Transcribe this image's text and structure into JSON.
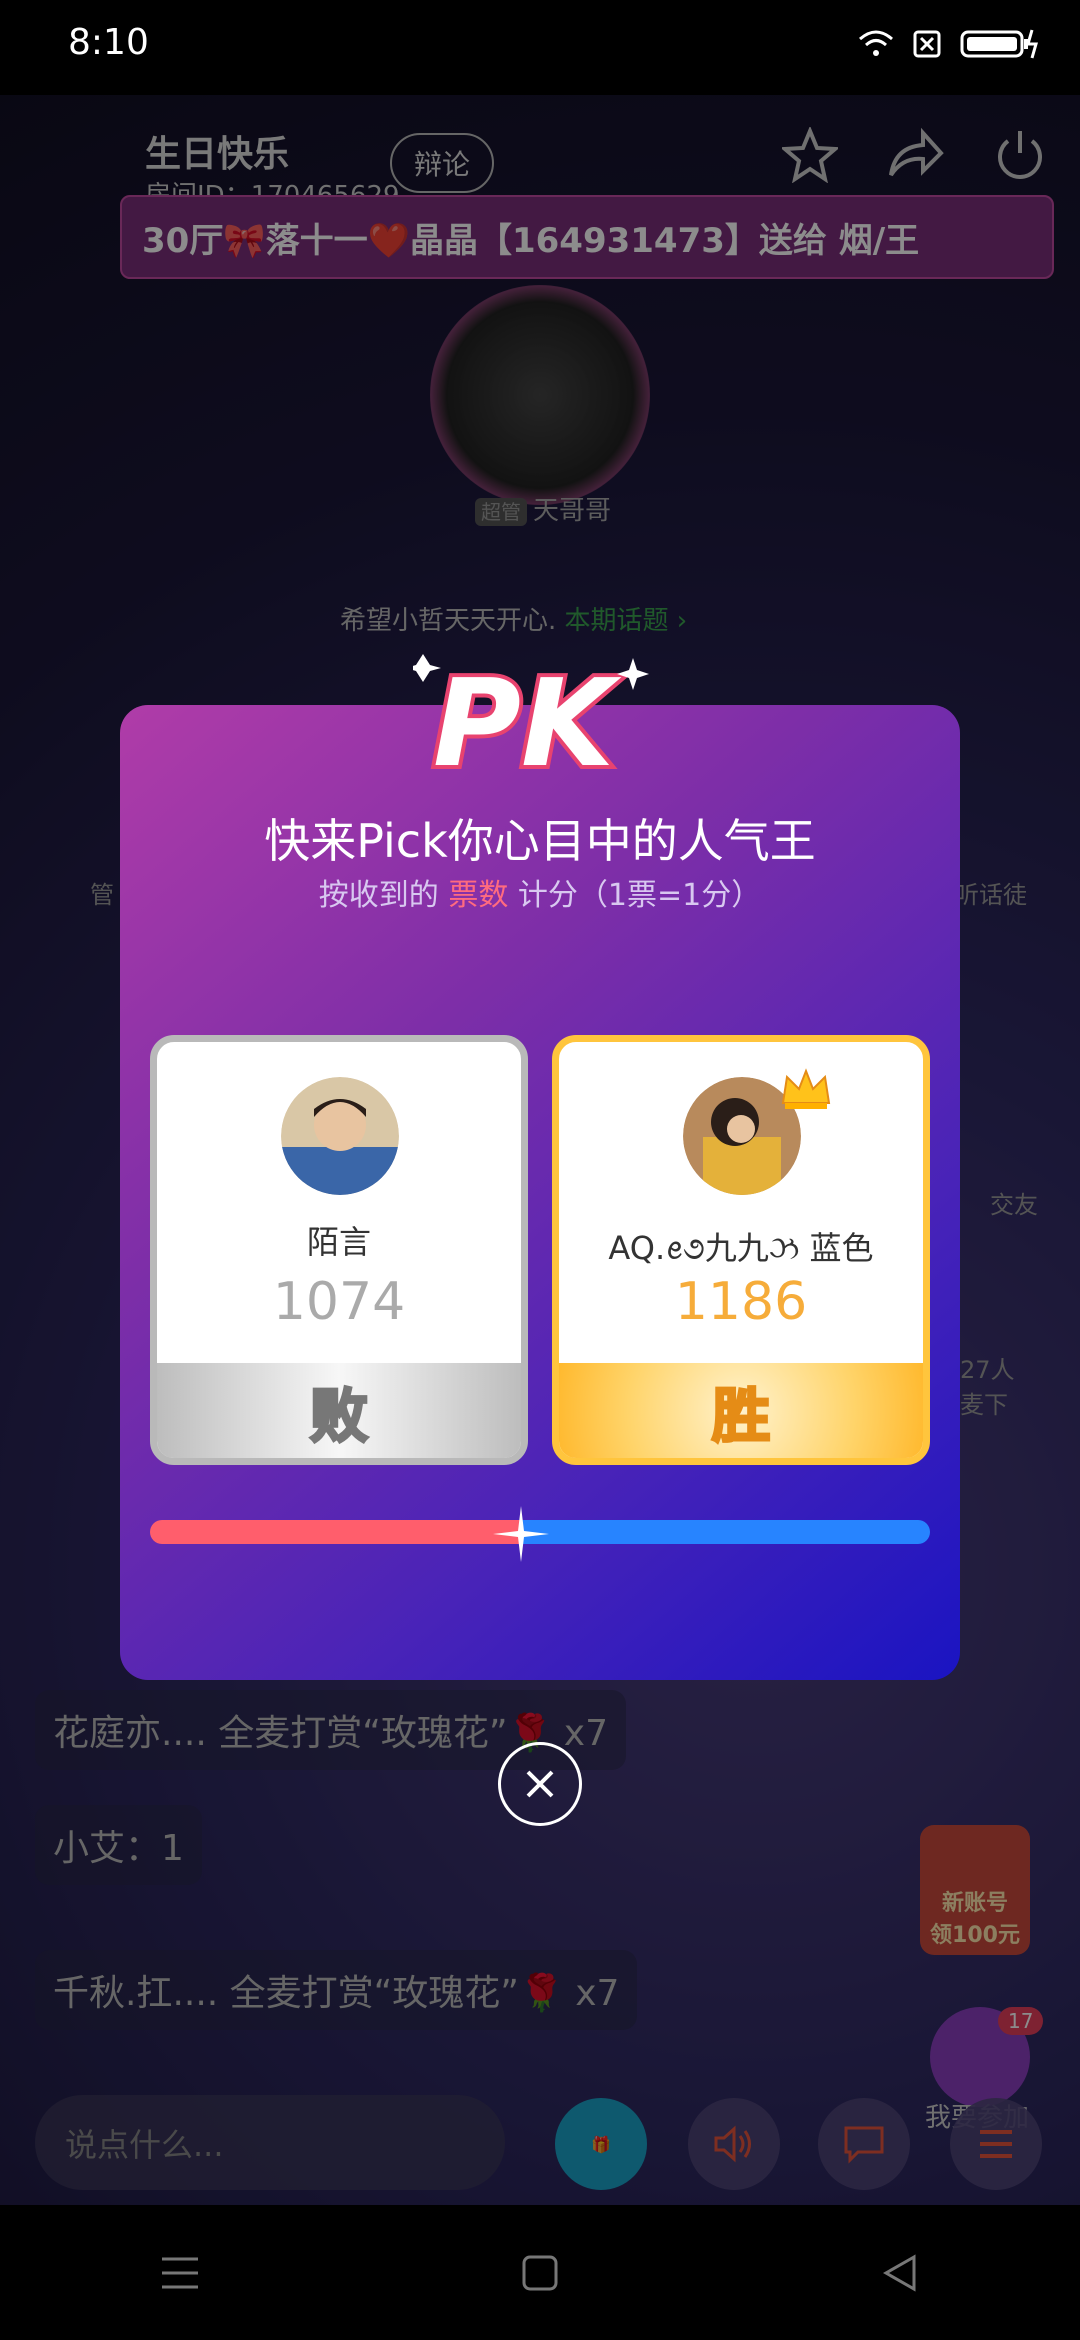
{
  "status_bar": {
    "time": "8:10"
  },
  "room": {
    "title": "生日快乐",
    "id_text": "房间ID：170465629",
    "debate_label": "辩论",
    "marquee_text": "30厅🎀落十一❤️晶晶【164931473】送给 烟/王",
    "host": {
      "badge": "超管",
      "name": "天哥哥"
    },
    "topic": {
      "text": "希望小哲天天开心.",
      "link": "本期话题 ›"
    },
    "side_labels": {
      "left_top": "管",
      "right_top": "听话徒",
      "right_mid": "交友",
      "right_low": "27人\n麦下"
    },
    "chat": [
      {
        "text": "花庭亦.... 全麦打赏“玫瑰花”🌹 x7"
      },
      {
        "text": "小艾：1"
      },
      {
        "text": "千秋.扛.... 全麦打赏“玫瑰花”🌹 x7"
      }
    ],
    "input_placeholder": "说点什么...",
    "promo_text": "新账号\n领100元",
    "join": {
      "count": "17",
      "label": "我要参加"
    }
  },
  "modal": {
    "logo": "PK",
    "title": "快来Pick你心目中的人气王",
    "subtitle_prefix": "按收到的 ",
    "subtitle_highlight": "票数",
    "subtitle_suffix": " 计分（1票=1分）",
    "left": {
      "name": "陌言",
      "score": "1074",
      "result": "败",
      "share": 0.475
    },
    "right": {
      "name": "AQ.ꫀ૭九九ઝ 蓝色",
      "score": "1186",
      "result": "胜",
      "share": 0.525
    }
  },
  "colors": {
    "accent_red": "#ff5e6c",
    "accent_blue": "#2784ff",
    "win_gold": "#f6ac3a"
  }
}
